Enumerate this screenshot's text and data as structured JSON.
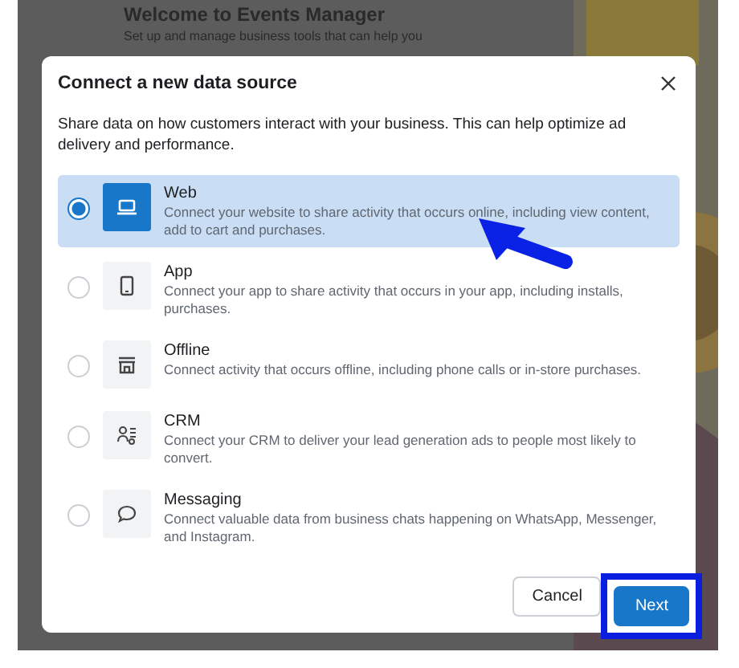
{
  "background_page": {
    "title": "Welcome to Events Manager",
    "subtitle": "Set up and manage business tools that can help you"
  },
  "dialog": {
    "title": "Connect a new data source",
    "description": "Share data on how customers interact with your business. This can help optimize ad delivery and performance.",
    "options": [
      {
        "kind": "web",
        "title": "Web",
        "description": "Connect your website to share activity that occurs online, including view content, add to cart and purchases.",
        "selected": true
      },
      {
        "kind": "app",
        "title": "App",
        "description": "Connect your app to share activity that occurs in your app, including installs, purchases.",
        "selected": false
      },
      {
        "kind": "offline",
        "title": "Offline",
        "description": "Connect activity that occurs offline, including phone calls or in-store purchases.",
        "selected": false
      },
      {
        "kind": "crm",
        "title": "CRM",
        "description": "Connect your CRM to deliver your lead generation ads to people most likely to convert.",
        "selected": false
      },
      {
        "kind": "messaging",
        "title": "Messaging",
        "description": "Connect valuable data from business chats happening on WhatsApp, Messenger, and Instagram.",
        "selected": false
      }
    ],
    "buttons": [
      {
        "kind": "secondary",
        "label": "Cancel",
        "highlighted": false
      },
      {
        "kind": "primary",
        "label": "Next",
        "highlighted": true
      }
    ]
  }
}
